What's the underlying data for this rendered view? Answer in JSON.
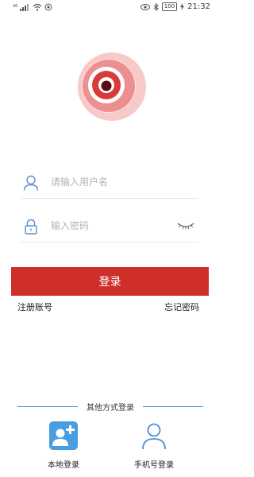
{
  "status_bar": {
    "left_text": "46",
    "battery": "100",
    "time": "21:32"
  },
  "colors": {
    "primary_red": "#cf2f2a",
    "logo_light": "#f4a6a6",
    "icon_blue": "#4a8ed8",
    "placeholder": "#b3b3b3"
  },
  "login_form": {
    "username_placeholder": "请输入用户名",
    "password_placeholder": "输入密码",
    "login_label": "登录",
    "register_label": "注册账号",
    "forgot_label": "忘记密码"
  },
  "other_login": {
    "title": "其他方式登录",
    "options": [
      {
        "label": "本地登录",
        "icon": "add-user-icon"
      },
      {
        "label": "手机号登录",
        "icon": "person-icon"
      }
    ]
  }
}
